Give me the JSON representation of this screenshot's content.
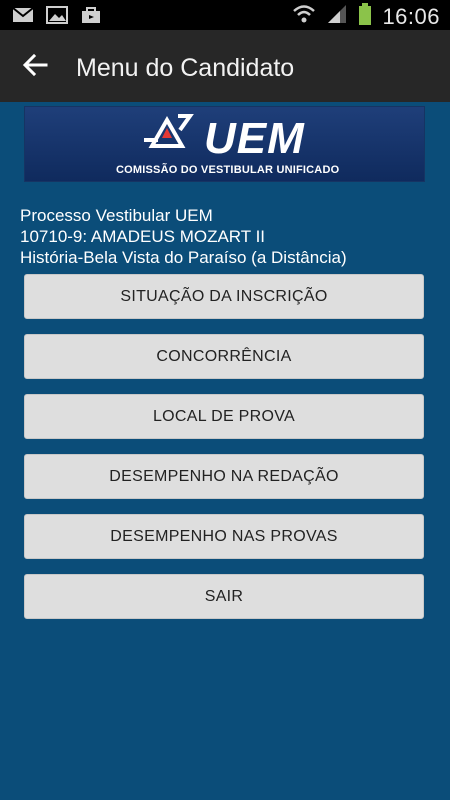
{
  "status_bar": {
    "icons_left": [
      "gmail-icon",
      "gallery-icon",
      "store-icon"
    ],
    "icons_right": [
      "wifi-icon",
      "signal-icon",
      "battery-icon"
    ],
    "time": "16:06"
  },
  "action_bar": {
    "back_icon": "arrow-left-icon",
    "title": "Menu do Candidato"
  },
  "banner": {
    "logo_text": "UEM",
    "subtitle": "COMISSÃO DO VESTIBULAR UNIFICADO"
  },
  "candidate": {
    "process": "Processo Vestibular UEM",
    "name_line": "10710-9: AMADEUS MOZART II",
    "course": "História-Bela Vista do Paraíso (a Distância)"
  },
  "menu": {
    "items": [
      "SITUAÇÃO DA INSCRIÇÃO",
      "CONCORRÊNCIA",
      "LOCAL DE PROVA",
      "DESEMPENHO NA REDAÇÃO",
      "DESEMPENHO NAS PROVAS",
      "SAIR"
    ]
  },
  "colors": {
    "background": "#0b4d79",
    "action_bar": "#272727",
    "button": "#dedede"
  }
}
